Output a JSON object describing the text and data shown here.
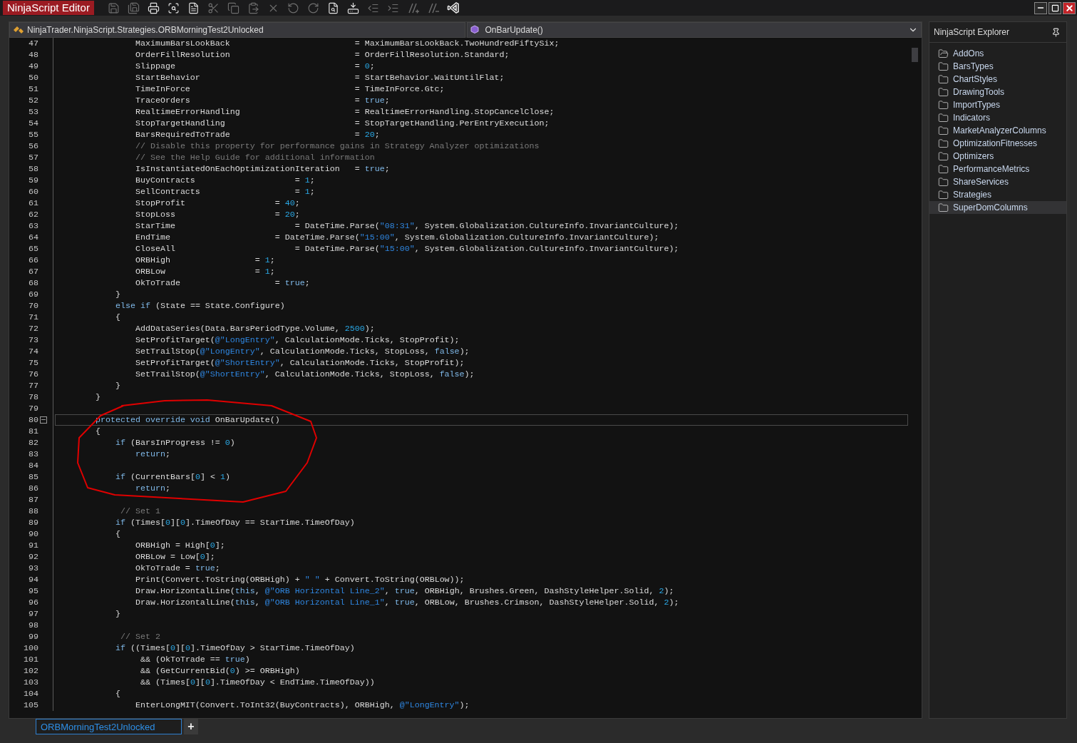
{
  "window": {
    "title": "NinjaScript Editor"
  },
  "toolbar": [
    {
      "kind": "save",
      "disabled": true
    },
    {
      "kind": "save-all",
      "disabled": true
    },
    {
      "kind": "print",
      "disabled": false
    },
    {
      "kind": "print-preview",
      "disabled": false
    },
    {
      "kind": "properties",
      "disabled": false
    },
    {
      "kind": "cut",
      "disabled": true
    },
    {
      "kind": "copy",
      "disabled": true
    },
    {
      "kind": "paste",
      "disabled": true
    },
    {
      "kind": "delete",
      "disabled": true
    },
    {
      "kind": "undo",
      "disabled": true
    },
    {
      "kind": "redo",
      "disabled": true
    },
    {
      "kind": "find",
      "disabled": false
    },
    {
      "kind": "compile",
      "disabled": false
    },
    {
      "kind": "outdent",
      "disabled": true
    },
    {
      "kind": "indent",
      "disabled": true
    },
    {
      "kind": "comment",
      "disabled": true
    },
    {
      "kind": "uncomment",
      "disabled": true
    },
    {
      "kind": "visual-studio",
      "disabled": false
    }
  ],
  "editor": {
    "type_selector": "NinjaTrader.NinjaScript.Strategies.ORBMorningTest2Unlocked",
    "member_selector": "OnBarUpdate()",
    "lines": [
      {
        "number": "47",
        "current": false,
        "tokens": [
          {
            "kind": "plain",
            "text": "                MaximumBarsLookBack                         = MaximumBarsLookBack.TwoHundredFiftySix;"
          }
        ]
      },
      {
        "number": "48",
        "current": false,
        "tokens": [
          {
            "kind": "plain",
            "text": "                OrderFillResolution                         = OrderFillResolution.Standard;"
          }
        ]
      },
      {
        "number": "49",
        "current": false,
        "tokens": [
          {
            "kind": "plain",
            "text": "                Slippage                                    = "
          },
          {
            "kind": "number",
            "text": "0"
          },
          {
            "kind": "plain",
            "text": ";"
          }
        ]
      },
      {
        "number": "50",
        "current": false,
        "tokens": [
          {
            "kind": "plain",
            "text": "                StartBehavior                               = StartBehavior.WaitUntilFlat;"
          }
        ]
      },
      {
        "number": "51",
        "current": false,
        "tokens": [
          {
            "kind": "plain",
            "text": "                TimeInForce                                 = TimeInForce.Gtc;"
          }
        ]
      },
      {
        "number": "52",
        "current": false,
        "tokens": [
          {
            "kind": "plain",
            "text": "                TraceOrders                                 = "
          },
          {
            "kind": "keyword",
            "text": "true"
          },
          {
            "kind": "plain",
            "text": ";"
          }
        ]
      },
      {
        "number": "53",
        "current": false,
        "tokens": [
          {
            "kind": "plain",
            "text": "                RealtimeErrorHandling                       = RealtimeErrorHandling.StopCancelClose;"
          }
        ]
      },
      {
        "number": "54",
        "current": false,
        "tokens": [
          {
            "kind": "plain",
            "text": "                StopTargetHandling                          = StopTargetHandling.PerEntryExecution;"
          }
        ]
      },
      {
        "number": "55",
        "current": false,
        "tokens": [
          {
            "kind": "plain",
            "text": "                BarsRequiredToTrade                         = "
          },
          {
            "kind": "number",
            "text": "20"
          },
          {
            "kind": "plain",
            "text": ";"
          }
        ]
      },
      {
        "number": "56",
        "current": false,
        "tokens": [
          {
            "kind": "comment",
            "text": "                // Disable this property for performance gains in Strategy Analyzer optimizations"
          }
        ]
      },
      {
        "number": "57",
        "current": false,
        "tokens": [
          {
            "kind": "comment",
            "text": "                // See the Help Guide for additional information"
          }
        ]
      },
      {
        "number": "58",
        "current": false,
        "tokens": [
          {
            "kind": "plain",
            "text": "                IsInstantiatedOnEachOptimizationIteration   = "
          },
          {
            "kind": "keyword",
            "text": "true"
          },
          {
            "kind": "plain",
            "text": ";"
          }
        ]
      },
      {
        "number": "59",
        "current": false,
        "tokens": [
          {
            "kind": "plain",
            "text": "                BuyContracts                    = "
          },
          {
            "kind": "number",
            "text": "1"
          },
          {
            "kind": "plain",
            "text": ";"
          }
        ]
      },
      {
        "number": "60",
        "current": false,
        "tokens": [
          {
            "kind": "plain",
            "text": "                SellContracts                   = "
          },
          {
            "kind": "number",
            "text": "1"
          },
          {
            "kind": "plain",
            "text": ";"
          }
        ]
      },
      {
        "number": "61",
        "current": false,
        "tokens": [
          {
            "kind": "plain",
            "text": "                StopProfit                  = "
          },
          {
            "kind": "number",
            "text": "40"
          },
          {
            "kind": "plain",
            "text": ";"
          }
        ]
      },
      {
        "number": "62",
        "current": false,
        "tokens": [
          {
            "kind": "plain",
            "text": "                StopLoss                    = "
          },
          {
            "kind": "number",
            "text": "20"
          },
          {
            "kind": "plain",
            "text": ";"
          }
        ]
      },
      {
        "number": "63",
        "current": false,
        "tokens": [
          {
            "kind": "plain",
            "text": "                StarTime                        = DateTime.Parse("
          },
          {
            "kind": "string",
            "text": "\"08:31\""
          },
          {
            "kind": "plain",
            "text": ", System.Globalization.CultureInfo.InvariantCulture);"
          }
        ]
      },
      {
        "number": "64",
        "current": false,
        "tokens": [
          {
            "kind": "plain",
            "text": "                EndTime                     = DateTime.Parse("
          },
          {
            "kind": "string",
            "text": "\"15:00\""
          },
          {
            "kind": "plain",
            "text": ", System.Globalization.CultureInfo.InvariantCulture);"
          }
        ]
      },
      {
        "number": "65",
        "current": false,
        "tokens": [
          {
            "kind": "plain",
            "text": "                CloseAll                        = DateTime.Parse("
          },
          {
            "kind": "string",
            "text": "\"15:00\""
          },
          {
            "kind": "plain",
            "text": ", System.Globalization.CultureInfo.InvariantCulture);"
          }
        ]
      },
      {
        "number": "66",
        "current": false,
        "tokens": [
          {
            "kind": "plain",
            "text": "                ORBHigh                 = "
          },
          {
            "kind": "number",
            "text": "1"
          },
          {
            "kind": "plain",
            "text": ";"
          }
        ]
      },
      {
        "number": "67",
        "current": false,
        "tokens": [
          {
            "kind": "plain",
            "text": "                ORBLow                  = "
          },
          {
            "kind": "number",
            "text": "1"
          },
          {
            "kind": "plain",
            "text": ";"
          }
        ]
      },
      {
        "number": "68",
        "current": false,
        "tokens": [
          {
            "kind": "plain",
            "text": "                OkToTrade                   = "
          },
          {
            "kind": "keyword",
            "text": "true"
          },
          {
            "kind": "plain",
            "text": ";"
          }
        ]
      },
      {
        "number": "69",
        "current": false,
        "tokens": [
          {
            "kind": "plain",
            "text": "            }"
          }
        ]
      },
      {
        "number": "70",
        "current": false,
        "tokens": [
          {
            "kind": "keyword",
            "text": "            else if"
          },
          {
            "kind": "plain",
            "text": " (State == State.Configure)"
          }
        ]
      },
      {
        "number": "71",
        "current": false,
        "tokens": [
          {
            "kind": "plain",
            "text": "            {"
          }
        ]
      },
      {
        "number": "72",
        "current": false,
        "tokens": [
          {
            "kind": "plain",
            "text": "                AddDataSeries(Data.BarsPeriodType.Volume, "
          },
          {
            "kind": "number",
            "text": "2500"
          },
          {
            "kind": "plain",
            "text": ");"
          }
        ]
      },
      {
        "number": "73",
        "current": false,
        "tokens": [
          {
            "kind": "plain",
            "text": "                SetProfitTarget("
          },
          {
            "kind": "string",
            "text": "@\"LongEntry\""
          },
          {
            "kind": "plain",
            "text": ", CalculationMode.Ticks, StopProfit);"
          }
        ]
      },
      {
        "number": "74",
        "current": false,
        "tokens": [
          {
            "kind": "plain",
            "text": "                SetTrailStop("
          },
          {
            "kind": "string",
            "text": "@\"LongEntry\""
          },
          {
            "kind": "plain",
            "text": ", CalculationMode.Ticks, StopLoss, "
          },
          {
            "kind": "keyword",
            "text": "false"
          },
          {
            "kind": "plain",
            "text": ");"
          }
        ]
      },
      {
        "number": "75",
        "current": false,
        "tokens": [
          {
            "kind": "plain",
            "text": "                SetProfitTarget("
          },
          {
            "kind": "string",
            "text": "@\"ShortEntry\""
          },
          {
            "kind": "plain",
            "text": ", CalculationMode.Ticks, StopProfit);"
          }
        ]
      },
      {
        "number": "76",
        "current": false,
        "tokens": [
          {
            "kind": "plain",
            "text": "                SetTrailStop("
          },
          {
            "kind": "string",
            "text": "@\"ShortEntry\""
          },
          {
            "kind": "plain",
            "text": ", CalculationMode.Ticks, StopLoss, "
          },
          {
            "kind": "keyword",
            "text": "false"
          },
          {
            "kind": "plain",
            "text": ");"
          }
        ]
      },
      {
        "number": "77",
        "current": false,
        "tokens": [
          {
            "kind": "plain",
            "text": "            }"
          }
        ]
      },
      {
        "number": "78",
        "current": false,
        "tokens": [
          {
            "kind": "plain",
            "text": "        }"
          }
        ]
      },
      {
        "number": "79",
        "current": false
      },
      {
        "number": "80",
        "current": true,
        "fold_marker": true,
        "tokens": [
          {
            "kind": "keyword",
            "text": "        protected override void"
          },
          {
            "kind": "plain",
            "text": " OnBarUpdate()"
          }
        ]
      },
      {
        "number": "81",
        "current": false,
        "tokens": [
          {
            "kind": "plain",
            "text": "        {"
          }
        ]
      },
      {
        "number": "82",
        "current": false,
        "tokens": [
          {
            "kind": "keyword",
            "text": "            if"
          },
          {
            "kind": "plain",
            "text": " (BarsInProgress != "
          },
          {
            "kind": "number",
            "text": "0"
          },
          {
            "kind": "plain",
            "text": ")"
          }
        ]
      },
      {
        "number": "83",
        "current": false,
        "tokens": [
          {
            "kind": "keyword",
            "text": "                return"
          },
          {
            "kind": "plain",
            "text": ";"
          }
        ]
      },
      {
        "number": "84",
        "current": false
      },
      {
        "number": "85",
        "current": false,
        "tokens": [
          {
            "kind": "keyword",
            "text": "            if"
          },
          {
            "kind": "plain",
            "text": " (CurrentBars["
          },
          {
            "kind": "number",
            "text": "0"
          },
          {
            "kind": "plain",
            "text": "] < "
          },
          {
            "kind": "number",
            "text": "1"
          },
          {
            "kind": "plain",
            "text": ")"
          }
        ]
      },
      {
        "number": "86",
        "current": false,
        "tokens": [
          {
            "kind": "keyword",
            "text": "                return"
          },
          {
            "kind": "plain",
            "text": ";"
          }
        ]
      },
      {
        "number": "87",
        "current": false
      },
      {
        "number": "88",
        "current": false,
        "tokens": [
          {
            "kind": "comment",
            "text": "             // Set 1"
          }
        ]
      },
      {
        "number": "89",
        "current": false,
        "tokens": [
          {
            "kind": "keyword",
            "text": "            if"
          },
          {
            "kind": "plain",
            "text": " (Times["
          },
          {
            "kind": "number",
            "text": "0"
          },
          {
            "kind": "plain",
            "text": "]["
          },
          {
            "kind": "number",
            "text": "0"
          },
          {
            "kind": "plain",
            "text": "].TimeOfDay == StarTime.TimeOfDay)"
          }
        ]
      },
      {
        "number": "90",
        "current": false,
        "tokens": [
          {
            "kind": "plain",
            "text": "            {"
          }
        ]
      },
      {
        "number": "91",
        "current": false,
        "tokens": [
          {
            "kind": "plain",
            "text": "                ORBHigh = High["
          },
          {
            "kind": "number",
            "text": "0"
          },
          {
            "kind": "plain",
            "text": "];"
          }
        ]
      },
      {
        "number": "92",
        "current": false,
        "tokens": [
          {
            "kind": "plain",
            "text": "                ORBLow = Low["
          },
          {
            "kind": "number",
            "text": "0"
          },
          {
            "kind": "plain",
            "text": "];"
          }
        ]
      },
      {
        "number": "93",
        "current": false,
        "tokens": [
          {
            "kind": "plain",
            "text": "                OkToTrade = "
          },
          {
            "kind": "keyword",
            "text": "true"
          },
          {
            "kind": "plain",
            "text": ";"
          }
        ]
      },
      {
        "number": "94",
        "current": false,
        "tokens": [
          {
            "kind": "plain",
            "text": "                Print(Convert.ToString(ORBHigh) + "
          },
          {
            "kind": "string",
            "text": "\" \""
          },
          {
            "kind": "plain",
            "text": " + Convert.ToString(ORBLow));"
          }
        ]
      },
      {
        "number": "95",
        "current": false,
        "tokens": [
          {
            "kind": "plain",
            "text": "                Draw.HorizontalLine("
          },
          {
            "kind": "keyword",
            "text": "this"
          },
          {
            "kind": "plain",
            "text": ", "
          },
          {
            "kind": "string",
            "text": "@\"ORB Horizontal Line_2\""
          },
          {
            "kind": "plain",
            "text": ", "
          },
          {
            "kind": "keyword",
            "text": "true"
          },
          {
            "kind": "plain",
            "text": ", ORBHigh, Brushes.Green, DashStyleHelper.Solid, "
          },
          {
            "kind": "number",
            "text": "2"
          },
          {
            "kind": "plain",
            "text": ");"
          }
        ]
      },
      {
        "number": "96",
        "current": false,
        "tokens": [
          {
            "kind": "plain",
            "text": "                Draw.HorizontalLine("
          },
          {
            "kind": "keyword",
            "text": "this"
          },
          {
            "kind": "plain",
            "text": ", "
          },
          {
            "kind": "string",
            "text": "@\"ORB Horizontal Line_1\""
          },
          {
            "kind": "plain",
            "text": ", "
          },
          {
            "kind": "keyword",
            "text": "true"
          },
          {
            "kind": "plain",
            "text": ", ORBLow, Brushes.Crimson, DashStyleHelper.Solid, "
          },
          {
            "kind": "number",
            "text": "2"
          },
          {
            "kind": "plain",
            "text": ");"
          }
        ]
      },
      {
        "number": "97",
        "current": false,
        "tokens": [
          {
            "kind": "plain",
            "text": "            }"
          }
        ]
      },
      {
        "number": "98",
        "current": false
      },
      {
        "number": "99",
        "current": false,
        "tokens": [
          {
            "kind": "comment",
            "text": "             // Set 2"
          }
        ]
      },
      {
        "number": "100",
        "current": false,
        "tokens": [
          {
            "kind": "keyword",
            "text": "            if"
          },
          {
            "kind": "plain",
            "text": " ((Times["
          },
          {
            "kind": "number",
            "text": "0"
          },
          {
            "kind": "plain",
            "text": "]["
          },
          {
            "kind": "number",
            "text": "0"
          },
          {
            "kind": "plain",
            "text": "].TimeOfDay > StarTime.TimeOfDay)"
          }
        ]
      },
      {
        "number": "101",
        "current": false,
        "tokens": [
          {
            "kind": "plain",
            "text": "                 && (OkToTrade == "
          },
          {
            "kind": "keyword",
            "text": "true"
          },
          {
            "kind": "plain",
            "text": ")"
          }
        ]
      },
      {
        "number": "102",
        "current": false,
        "tokens": [
          {
            "kind": "plain",
            "text": "                 && (GetCurrentBid("
          },
          {
            "kind": "number",
            "text": "0"
          },
          {
            "kind": "plain",
            "text": ") >= ORBHigh)"
          }
        ]
      },
      {
        "number": "103",
        "current": false,
        "tokens": [
          {
            "kind": "plain",
            "text": "                 && (Times["
          },
          {
            "kind": "number",
            "text": "0"
          },
          {
            "kind": "plain",
            "text": "]["
          },
          {
            "kind": "number",
            "text": "0"
          },
          {
            "kind": "plain",
            "text": "].TimeOfDay < EndTime.TimeOfDay))"
          }
        ]
      },
      {
        "number": "104",
        "current": false,
        "tokens": [
          {
            "kind": "plain",
            "text": "            {"
          }
        ]
      },
      {
        "number": "105",
        "current": false,
        "tokens": [
          {
            "kind": "plain",
            "text": "                EnterLongMIT(Convert.ToInt32(BuyContracts), ORBHigh, "
          },
          {
            "kind": "string",
            "text": "@\"LongEntry\""
          },
          {
            "kind": "plain",
            "text": ");"
          }
        ]
      }
    ]
  },
  "explorer": {
    "title": "NinjaScript Explorer",
    "items": [
      {
        "label": "AddOns",
        "open": true,
        "selected": false
      },
      {
        "label": "BarsTypes",
        "open": false,
        "selected": false
      },
      {
        "label": "ChartStyles",
        "open": false,
        "selected": false
      },
      {
        "label": "DrawingTools",
        "open": false,
        "selected": false
      },
      {
        "label": "ImportTypes",
        "open": false,
        "selected": false
      },
      {
        "label": "Indicators",
        "open": false,
        "selected": false
      },
      {
        "label": "MarketAnalyzerColumns",
        "open": false,
        "selected": false
      },
      {
        "label": "OptimizationFitnesses",
        "open": false,
        "selected": false
      },
      {
        "label": "Optimizers",
        "open": false,
        "selected": false
      },
      {
        "label": "PerformanceMetrics",
        "open": false,
        "selected": false
      },
      {
        "label": "ShareServices",
        "open": false,
        "selected": false
      },
      {
        "label": "Strategies",
        "open": false,
        "selected": false
      },
      {
        "label": "SuperDomColumns",
        "open": false,
        "selected": true
      }
    ]
  },
  "file_tabs": [
    {
      "label": "ORBMorningTest2Unlocked",
      "selected": true
    }
  ],
  "add_tab": "+"
}
